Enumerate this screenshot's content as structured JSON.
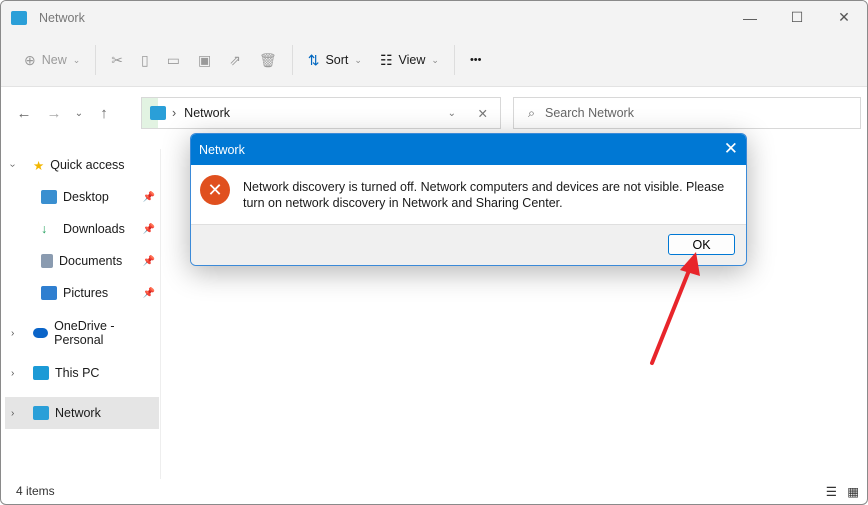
{
  "window": {
    "title": "Network"
  },
  "toolbar": {
    "new": "New",
    "sort": "Sort",
    "view": "View",
    "more": "•••"
  },
  "address": {
    "crumb": "Network",
    "search_placeholder": "Search Network"
  },
  "sidebar": {
    "items": [
      {
        "label": "Quick access"
      },
      {
        "label": "Desktop"
      },
      {
        "label": "Downloads"
      },
      {
        "label": "Documents"
      },
      {
        "label": "Pictures"
      },
      {
        "label": "OneDrive - Personal"
      },
      {
        "label": "This PC"
      },
      {
        "label": "Network"
      }
    ]
  },
  "status": {
    "count": "4 items"
  },
  "dialog": {
    "title": "Network",
    "message": "Network discovery is turned off. Network computers and devices are not visible. Please turn on network discovery in Network and Sharing Center.",
    "ok": "OK"
  },
  "colors": {
    "accent": "#0078d4",
    "error": "#e0501f",
    "annotation": "#e8252b"
  }
}
